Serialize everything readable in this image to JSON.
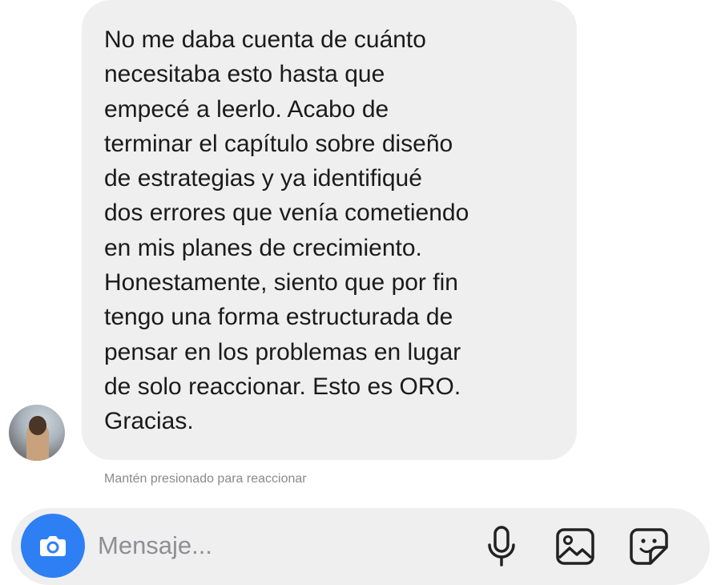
{
  "message": {
    "lines": [
      "No me daba cuenta de cuánto",
      "necesitaba esto hasta que",
      "empecé a leerlo. Acabo de",
      "terminar el capítulo sobre diseño",
      "de estrategias y ya identifiqué",
      "dos errores que venía cometiendo",
      "en mis planes de crecimiento.",
      "Honestamente, siento que por fin",
      "tengo una forma estructurada de",
      "pensar en los problemas en lugar",
      "de solo reaccionar. Esto es ORO.",
      "Gracias."
    ],
    "hint": "Mantén presionado para reaccionar"
  },
  "composer": {
    "placeholder": "Mensaje...",
    "value": "",
    "icons": {
      "camera": "camera-icon",
      "mic": "microphone-icon",
      "gallery": "image-gallery-icon",
      "sticker": "sticker-icon"
    }
  },
  "colors": {
    "bubble": "#efeff0",
    "text": "#1b1b1b",
    "hint": "#8a8a8e",
    "accent": "#2f7ff4",
    "icon": "#222222"
  }
}
